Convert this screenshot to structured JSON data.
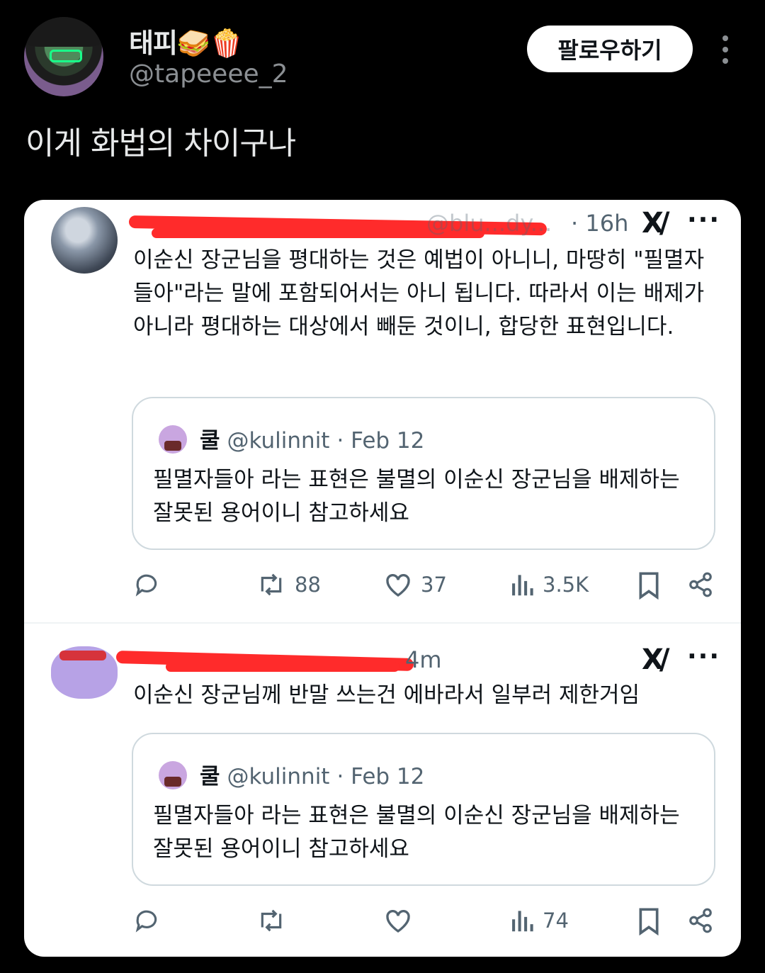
{
  "post": {
    "display_name": "태피🥪🍿",
    "handle": "@tapeeee_2",
    "follow_label": "팔로우하기",
    "text": "이게 화법의 차이구나"
  },
  "tweets": [
    {
      "handle_visible": "@blu...dy...",
      "time": "· 16h",
      "body": "이순신 장군님을 평대하는 것은 예법이 아니니, 마땅히 \"필멸자들아\"라는 말에 포함되어서는 아니 됩니다. 따라서 이는 배제가 아니라 평대하는 대상에서 빼둔 것이니, 합당한 표현입니다.",
      "quote": {
        "name": "쿨",
        "handle": "@kulinnit",
        "date": "· Feb 12",
        "body": "필멸자들아 라는 표현은 불멸의 이순신 장군님을 배제하는 잘못된 용어이니 참고하세요"
      },
      "stats": {
        "reposts": "88",
        "likes": "37",
        "views": "3.5K"
      }
    },
    {
      "time": "4m",
      "body": "이순신 장군님께 반말 쓰는건 에바라서 일부러 제한거임",
      "quote": {
        "name": "쿨",
        "handle": "@kulinnit",
        "date": "· Feb 12",
        "body": "필멸자들아 라는 표현은 불멸의 이순신 장군님을 배제하는 잘못된 용어이니 참고하세요"
      },
      "stats": {
        "reposts": "",
        "likes": "",
        "views": "74"
      }
    }
  ],
  "icons": {
    "reply": "reply-icon",
    "repost": "repost-icon",
    "like": "heart-icon",
    "views": "views-icon",
    "bookmark": "bookmark-icon",
    "share": "share-icon"
  },
  "colors": {
    "background": "#000000",
    "card": "#ffffff",
    "redaction": "#ff2b2b",
    "follow_button": "#ffffff"
  }
}
